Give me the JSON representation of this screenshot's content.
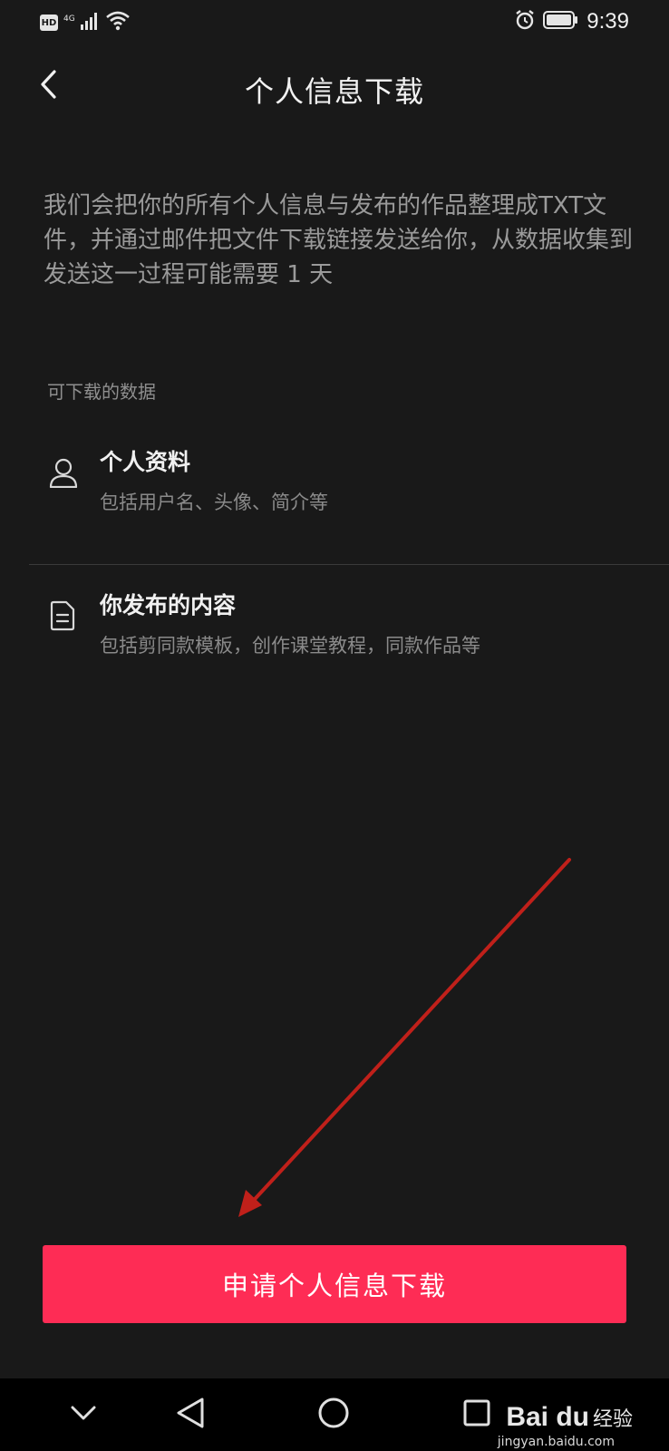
{
  "status_bar": {
    "hd": "HD",
    "network": "4G",
    "time": "9:39",
    "icons": [
      "signal-icon",
      "wifi-icon",
      "alarm-icon",
      "battery-icon"
    ]
  },
  "header": {
    "title": "个人信息下载",
    "back_icon": "chevron-left-icon"
  },
  "intro": {
    "text": "我们会把你的所有个人信息与发布的作品整理成TXT文件，并通过邮件把文件下载链接发送给你，从数据收集到发送这一过程可能需要 1 天"
  },
  "section": {
    "label": "可下载的数据"
  },
  "items": [
    {
      "icon": "user-icon",
      "title": "个人资料",
      "desc": "包括用户名、头像、简介等"
    },
    {
      "icon": "document-icon",
      "title": "你发布的内容",
      "desc": "包括剪同款模板，创作课堂教程，同款作品等"
    }
  ],
  "cta": {
    "label": "申请个人信息下载",
    "color": "#fe2c55"
  },
  "nav": [
    "chevron-down-icon",
    "back-triangle-icon",
    "home-circle-icon",
    "recents-square-icon"
  ],
  "watermark": {
    "brand": "Bai du",
    "cn": "经验",
    "url": "jingyan.baidu.com"
  },
  "annotation_color": "#c0201a"
}
